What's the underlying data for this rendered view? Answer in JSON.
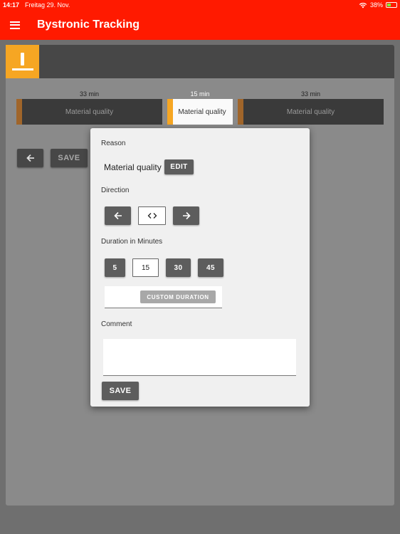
{
  "status_bar": {
    "time": "14:17",
    "date": "Freitag 29. Nov.",
    "battery": "38%"
  },
  "app": {
    "title": "Bystronic Tracking"
  },
  "timeline": {
    "segments": [
      {
        "duration": "33 min",
        "reason": "Material quality",
        "active": false
      },
      {
        "duration": "15 min",
        "reason": "Material quality",
        "active": true
      },
      {
        "duration": "33 min",
        "reason": "Material quality",
        "active": false
      }
    ],
    "save_label": "SAVE"
  },
  "dialog": {
    "reason_label": "Reason",
    "reason_value": "Material quality",
    "edit_label": "EDIT",
    "direction_label": "Direction",
    "duration_label": "Duration in Minutes",
    "durations": [
      "5",
      "15",
      "30",
      "45"
    ],
    "selected_duration": "15",
    "custom_duration_label": "CUSTOM DURATION",
    "comment_label": "Comment",
    "comment_value": "",
    "save_label": "SAVE"
  },
  "colors": {
    "appbar": "#ff1a00",
    "accent": "#f6a623"
  }
}
